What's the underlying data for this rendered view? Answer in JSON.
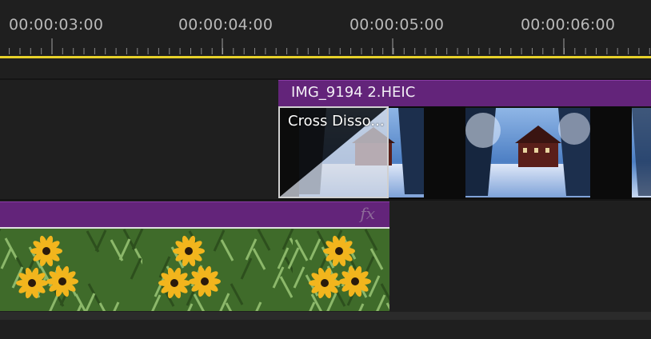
{
  "ruler": {
    "timecodes": [
      "00:00:03:00",
      "00:00:04:00",
      "00:00:05:00",
      "00:00:06:00"
    ]
  },
  "colors": {
    "background": "#1f1f1f",
    "clip_header": "#63247a",
    "playhead": "#e8d22a",
    "transition_border": "#d0d0d0"
  },
  "tracks": {
    "upper_clip": {
      "title": "IMG_9194 2.HEIC",
      "thumbnail": "snowy-house-thumbnail"
    },
    "transition": {
      "label": "Cross Disso..."
    },
    "lower_clip": {
      "fx_label": "fx",
      "thumbnail": "yellow-flowers-thumbnail"
    }
  }
}
